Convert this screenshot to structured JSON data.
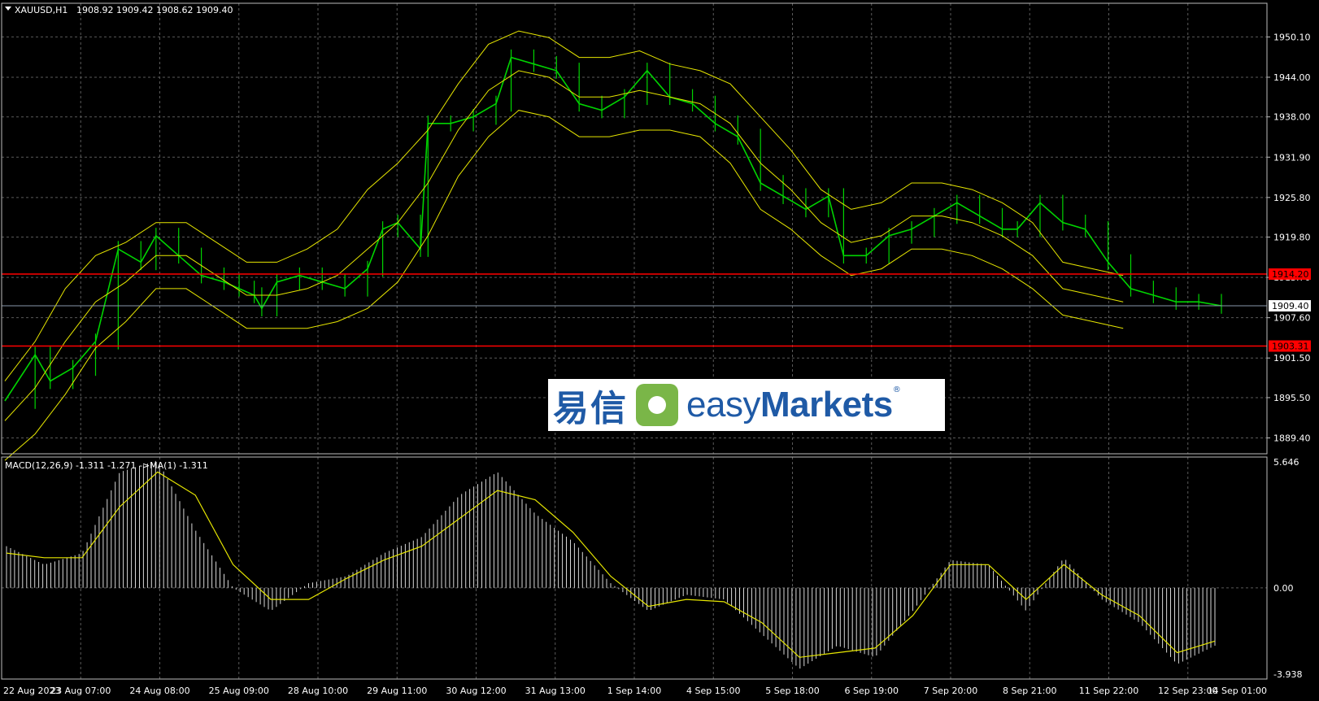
{
  "header": {
    "symbol": "XAUUSD,H1",
    "ohlc": "1908.92 1909.42 1908.62 1909.40"
  },
  "macd_header": {
    "label": "MACD(12,26,9) -1.311 -1.271  ->MA(1) -1.311"
  },
  "watermark": {
    "cn": "易信",
    "en_prefix": "easy",
    "en_suffix": "Markets",
    "reg": "®"
  },
  "colors": {
    "background": "#000000",
    "candle": "#00d400",
    "bands": "#e6e600",
    "grid": "#5a5a5a",
    "level_line": "#ff0000",
    "current_price_line": "#8899aa",
    "macd_hist": "#d8d8d8",
    "macd_signal": "#e6e600"
  },
  "chart_data": [
    {
      "type": "line",
      "title": "XAUUSD,H1",
      "subtitle": "1908.92 1909.42 1908.62 1909.40",
      "xlabel": "",
      "ylabel": "",
      "x_ticks": [
        "22 Aug 2023",
        "23 Aug 07:00",
        "24 Aug 08:00",
        "25 Aug 09:00",
        "28 Aug 10:00",
        "29 Aug 11:00",
        "30 Aug 12:00",
        "31 Aug 13:00",
        "1 Sep 14:00",
        "4 Sep 15:00",
        "5 Sep 18:00",
        "6 Sep 19:00",
        "7 Sep 20:00",
        "8 Sep 21:00",
        "11 Sep 22:00",
        "12 Sep 23:00",
        "14 Sep 01:00"
      ],
      "y_ticks": [
        "1950.10",
        "1944.00",
        "1938.00",
        "1931.90",
        "1925.80",
        "1919.80",
        "1913.70",
        "1907.60",
        "1901.50",
        "1895.50",
        "1889.40"
      ],
      "ylim": [
        1887.0,
        1955.2
      ],
      "grid": true,
      "horizontal_levels": [
        {
          "label": "1914.20",
          "value": 1914.2,
          "color": "#ff0000"
        },
        {
          "label": "1903.31",
          "value": 1903.31,
          "color": "#ff0000"
        }
      ],
      "current_price": {
        "label": "1909.40",
        "value": 1909.4
      },
      "x_index": [
        0,
        10,
        20,
        30,
        40,
        50,
        60,
        70,
        80,
        90,
        100,
        110,
        120,
        130,
        140,
        150,
        160
      ],
      "series": [
        {
          "values": [
            1895,
            1902,
            1898,
            1900,
            1904,
            1918,
            1916,
            1920,
            1917,
            1914,
            1913,
            1912,
            1911,
            1909,
            1913,
            1914,
            1913,
            1912,
            1915,
            1921,
            1922,
            1918,
            1937,
            1937,
            1938,
            1940,
            1947,
            1946,
            1945,
            1940,
            1939,
            1941,
            1945,
            1941,
            1940,
            1937,
            1935,
            1928,
            1926,
            1924,
            1926,
            1917,
            1917,
            1920,
            1921,
            1923,
            1925,
            1923,
            1921,
            1921,
            1925,
            1922,
            1921,
            1916,
            1912,
            1911,
            1910,
            1910,
            1909.4
          ],
          "x": [
            0,
            8,
            12,
            18,
            24,
            30,
            36,
            40,
            46,
            52,
            58,
            62,
            66,
            68,
            72,
            78,
            84,
            90,
            96,
            100,
            104,
            110,
            112,
            118,
            124,
            130,
            134,
            140,
            146,
            152,
            158,
            164,
            170,
            176,
            182,
            188,
            194,
            200,
            206,
            212,
            218,
            222,
            228,
            234,
            240,
            246,
            252,
            258,
            264,
            268,
            274,
            280,
            286,
            292,
            298,
            304,
            310,
            316,
            322
          ]
        },
        {
          "values": [
            1892,
            1897,
            1904,
            1910,
            1913,
            1917,
            1917,
            1914,
            1911,
            1911,
            1912,
            1914,
            1918,
            1922,
            1928,
            1936,
            1942,
            1945,
            1944,
            1941,
            1941,
            1942,
            1941,
            1940,
            1937,
            1931,
            1927,
            1922,
            1919,
            1920,
            1923,
            1923,
            1922,
            1920,
            1917,
            1912,
            1911,
            1910
          ],
          "x": [
            0,
            8,
            16,
            24,
            32,
            40,
            48,
            56,
            64,
            72,
            80,
            88,
            96,
            104,
            112,
            120,
            128,
            136,
            144,
            152,
            160,
            168,
            176,
            184,
            192,
            200,
            208,
            216,
            224,
            232,
            240,
            248,
            256,
            264,
            272,
            280,
            288,
            296
          ]
        }
      ]
    },
    {
      "type": "bar",
      "title": "MACD(12,26,9) -1.311 -1.271  ->MA(1) -1.311",
      "y_ticks": [
        "5.646",
        "0.00",
        "-3.938"
      ],
      "ylim": [
        -3.938,
        5.646
      ],
      "grid": true,
      "x": [
        0,
        10,
        20,
        30,
        40,
        50,
        60,
        70,
        80,
        90,
        100,
        110,
        120,
        130,
        140,
        150,
        160,
        170,
        180,
        190,
        200,
        210,
        220,
        230,
        240,
        250,
        260,
        270,
        280,
        290,
        300,
        310,
        320
      ],
      "series": [
        {
          "values": [
            1.8,
            1.0,
            1.5,
            5.0,
            5.5,
            2.5,
            0.0,
            -1.0,
            0.2,
            0.5,
            1.5,
            2.2,
            4.0,
            5.0,
            3.2,
            2.0,
            0.2,
            -1.0,
            -0.3,
            -0.5,
            -2.0,
            -3.5,
            -2.5,
            -3.0,
            -1.0,
            1.2,
            1.0,
            -1.0,
            1.3,
            -0.5,
            -1.5,
            -3.3,
            -2.5
          ]
        },
        {
          "values": [
            1.5,
            1.3,
            1.3,
            3.5,
            5.0,
            4.0,
            1.0,
            -0.5,
            -0.5,
            0.4,
            1.2,
            1.8,
            3.0,
            4.2,
            3.8,
            2.4,
            0.5,
            -0.8,
            -0.5,
            -0.6,
            -1.5,
            -3.0,
            -2.8,
            -2.6,
            -1.2,
            1.0,
            1.0,
            -0.5,
            1.0,
            -0.3,
            -1.2,
            -2.8,
            -2.3
          ]
        }
      ]
    }
  ]
}
